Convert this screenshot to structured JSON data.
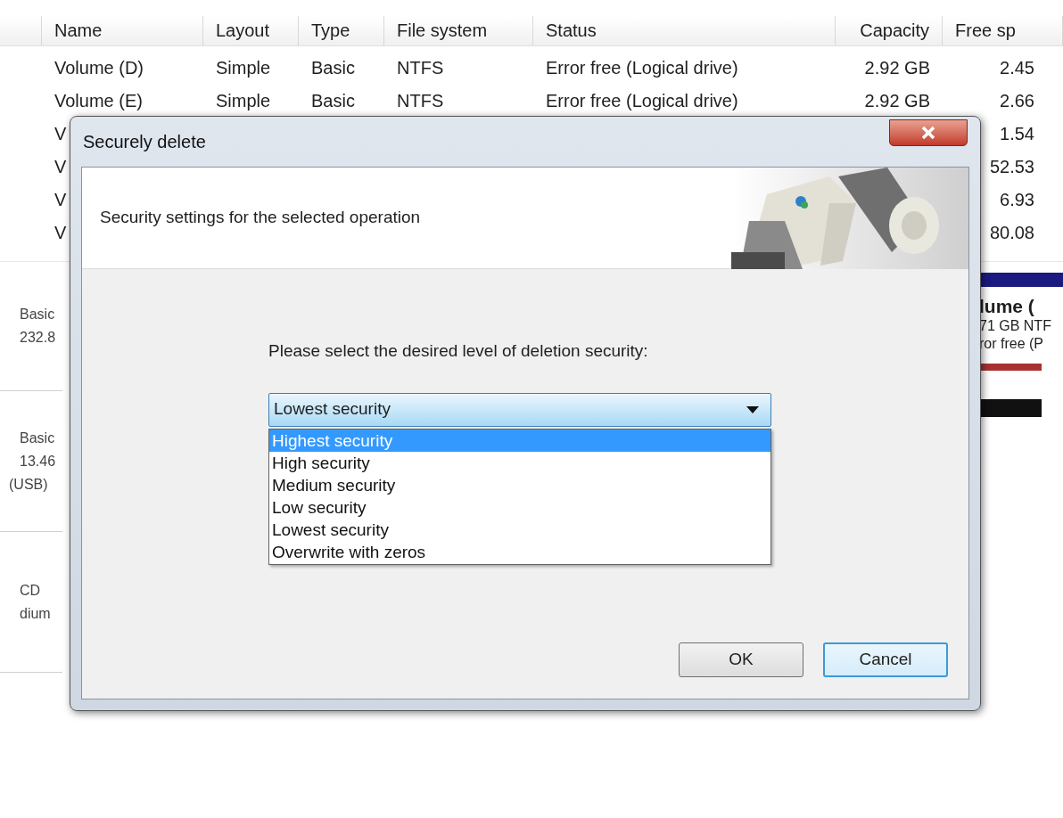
{
  "background": {
    "table": {
      "columns": [
        "Name",
        "Layout",
        "Type",
        "File system",
        "Status",
        "Capacity",
        "Free sp"
      ],
      "rows": [
        {
          "name": "Volume (D)",
          "layout": "Simple",
          "type": "Basic",
          "file_system": "NTFS",
          "status": "Error free (Logical drive)",
          "capacity": "2.92 GB",
          "free_space": "2.45"
        },
        {
          "name": "Volume (E)",
          "layout": "Simple",
          "type": "Basic",
          "file_system": "NTFS",
          "status": "Error free (Logical drive)",
          "capacity": "2.92 GB",
          "free_space": "2.66"
        },
        {
          "name": "V",
          "free_space": "1.54"
        },
        {
          "name": "V",
          "free_space": "52.53"
        },
        {
          "name": "V",
          "free_space": "6.93"
        },
        {
          "name": "V",
          "free_space": "80.08"
        }
      ]
    },
    "disks": [
      {
        "lines": [
          "Basic",
          "232.8"
        ]
      },
      {
        "lines": [
          "Basic",
          "13.46",
          "(USB)"
        ]
      },
      {
        "lines": [
          "CD",
          "dium"
        ]
      }
    ],
    "volume": {
      "name": "lume (",
      "size": "71 GB NTF",
      "status": "ror free (P"
    }
  },
  "dialog": {
    "title": "Securely delete",
    "header_text": "Security settings for the selected operation",
    "prompt": "Please select the desired level of deletion security:",
    "select": {
      "value": "Lowest security",
      "expanded": true,
      "options": [
        {
          "label": "Highest security",
          "highlighted": true
        },
        {
          "label": "High security",
          "highlighted": false
        },
        {
          "label": "Medium security",
          "highlighted": false
        },
        {
          "label": "Low security",
          "highlighted": false
        },
        {
          "label": "Lowest security",
          "highlighted": false
        },
        {
          "label": "Overwrite with zeros",
          "highlighted": false
        }
      ]
    },
    "buttons": [
      {
        "label": "OK",
        "focused": false
      },
      {
        "label": "Cancel",
        "focused": true
      }
    ]
  }
}
